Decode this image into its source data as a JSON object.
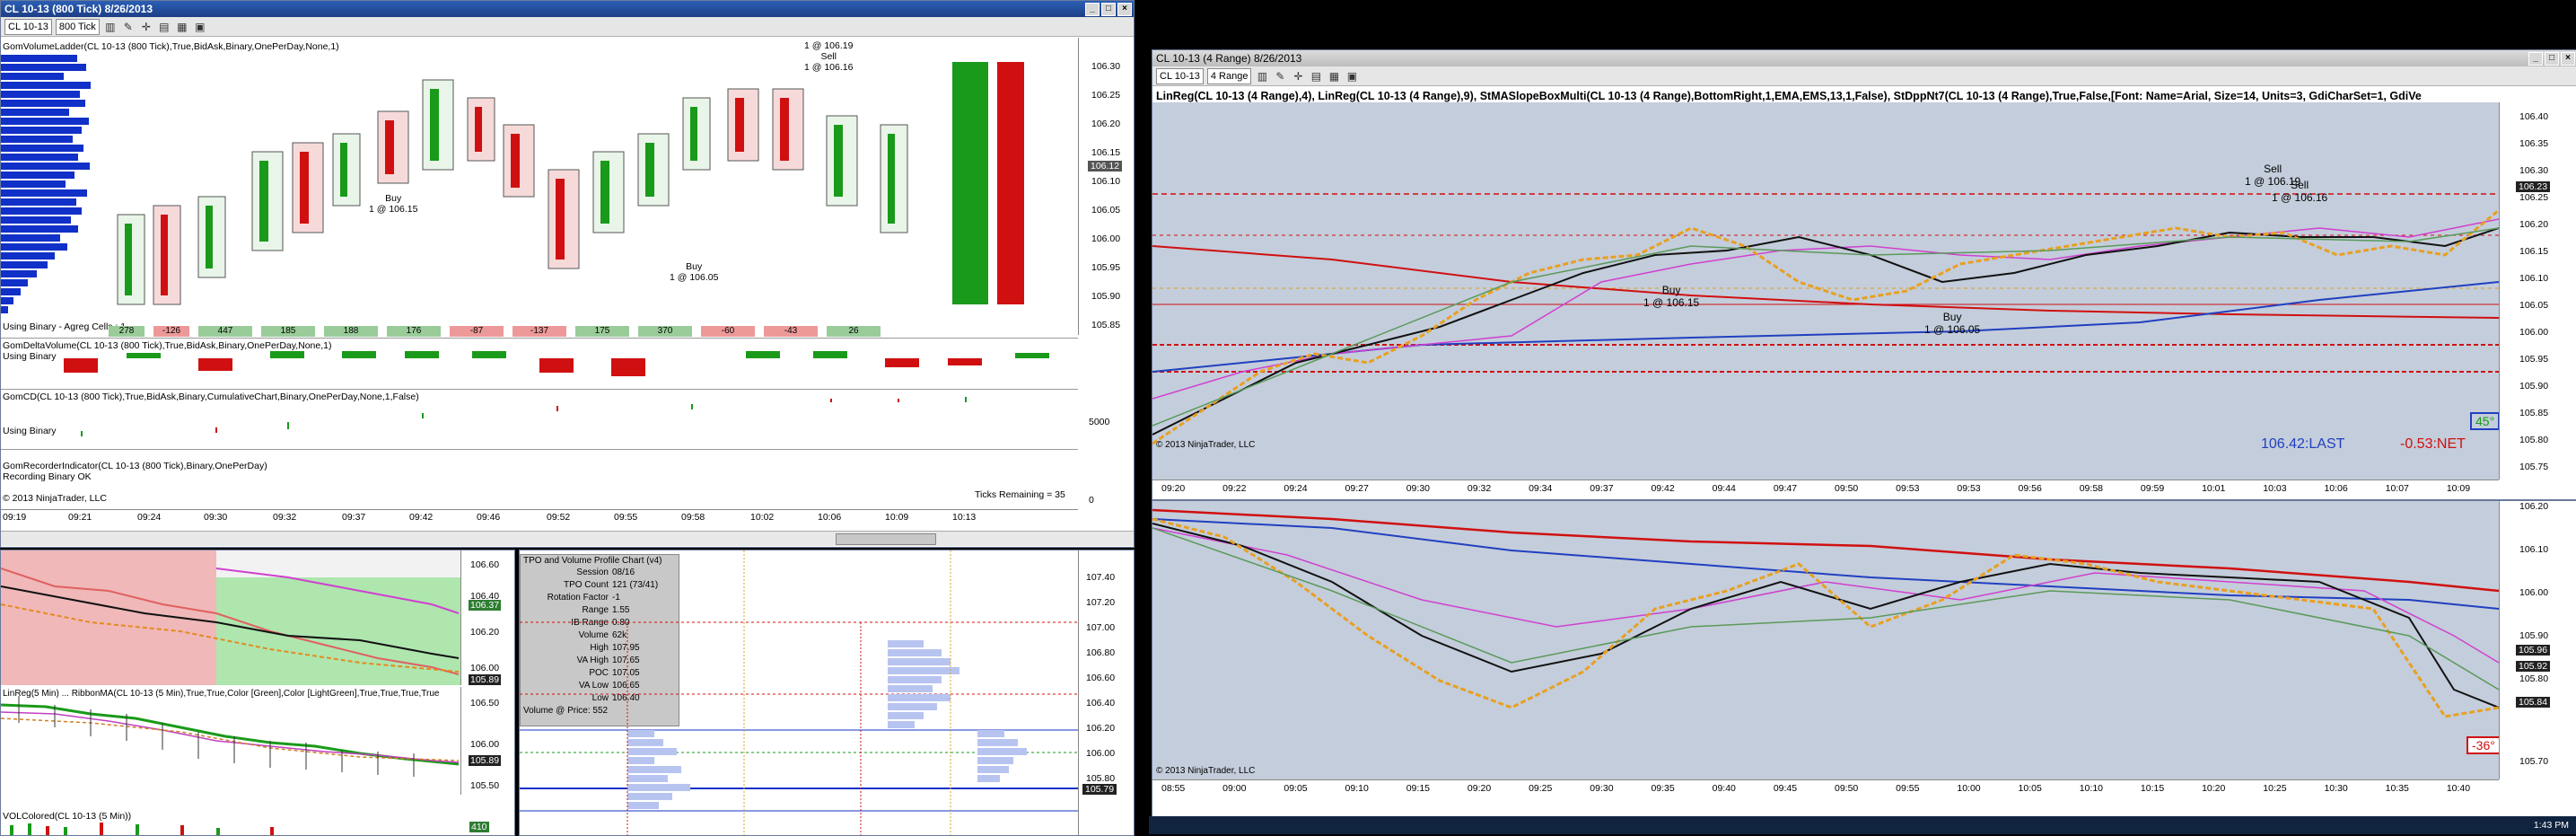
{
  "left_window": {
    "title": "CL 10-13 (800 Tick) 8/26/2013",
    "toolbar": {
      "instrument": "CL 10-13",
      "interval": "800 Tick"
    },
    "indicator_label": "GomVolumeLadder(CL 10-13 (800 Tick),True,BidAsk,Binary,OnePerDay,None,1)",
    "mode_label": "Using Binary - Agreg Cells : 1",
    "delta_label": "GomDeltaVolume(CL 10-13 (800 Tick),True,BidAsk,Binary,OnePerDay,None,1)",
    "delta_sub": "Using Binary",
    "cd_label": "GomCD(CL 10-13 (800 Tick),True,BidAsk,Binary,CumulativeChart,Binary,OnePerDay,None,1,False)",
    "cd_sub": "Using Binary",
    "recorder_label": "GomRecorderIndicator(CL 10-13 (800 Tick),Binary,OnePerDay)",
    "recorder_sub": "Recording Binary OK",
    "copyright": "© 2013 NinjaTrader, LLC",
    "ticks_remaining": "Ticks Remaining = 35",
    "cd_axis_value": "5000",
    "cd_axis_zero": "0",
    "delta_values": [
      "278",
      "-126",
      "447",
      "185",
      "188",
      "176",
      "-87",
      "-137",
      "175",
      "370",
      "-60",
      "-43",
      "26"
    ],
    "price_ticks": [
      "106.30",
      "106.25",
      "106.20",
      "106.15",
      "106.10",
      "106.05",
      "106.00",
      "105.95",
      "105.90",
      "105.85"
    ],
    "current_price": "106.12",
    "time_ticks": [
      "09:19",
      "09:21",
      "09:24",
      "09:30",
      "09:32",
      "09:37",
      "09:42",
      "09:46",
      "09:52",
      "09:55",
      "09:58",
      "10:02",
      "10:06",
      "10:09",
      "10:13"
    ],
    "trade_buy1": {
      "side": "Buy",
      "fill": "1 @ 106.15"
    },
    "trade_buy2": {
      "side": "Buy",
      "fill": "1 @ 106.05"
    },
    "trade_sell1": {
      "fill_top": "1 @ 106.19",
      "side": "Sell",
      "fill": "1 @ 106.16"
    }
  },
  "left_bottom": {
    "mini_chart_price_ticks": [
      "106.60",
      "106.40",
      "106.20",
      "106.00"
    ],
    "mini_chart_current": "106.37",
    "mini_chart_current2": "105.89",
    "mini2_label": "LinReg(5 Min) ... RibbonMA(CL 10-13 (5 Min),True,True,Color [Green],Color [LightGreen],True,True,True,True",
    "mini2_ticks": [
      "106.50",
      "106.00",
      "105.50"
    ],
    "mini2_current": "105.89",
    "vol_label": "VOLColored(CL 10-13 (5 Min))",
    "vol_value": "410"
  },
  "tpo_panel": {
    "title": "TPO and Volume Profile Chart (v4)",
    "rows": [
      {
        "k": "Session",
        "v": "08/16"
      },
      {
        "k": "TPO Count",
        "v": "121 (73/41)"
      },
      {
        "k": "Rotation Factor",
        "v": "-1"
      },
      {
        "k": "Range",
        "v": "1.55"
      },
      {
        "k": "IB Range",
        "v": "0.80"
      },
      {
        "k": "Volume",
        "v": "62k"
      },
      {
        "k": "High",
        "v": "107.95"
      },
      {
        "k": "VA High",
        "v": "107.65"
      },
      {
        "k": "POC",
        "v": "107.05"
      },
      {
        "k": "VA Low",
        "v": "106.65"
      },
      {
        "k": "Low",
        "v": "106.40"
      }
    ],
    "footer": "Volume @ Price: 552",
    "price_ticks": [
      "107.40",
      "107.20",
      "107.00",
      "106.80",
      "106.60",
      "106.40",
      "106.20",
      "106.00",
      "105.80"
    ],
    "current_price": "105.79"
  },
  "right_window": {
    "title": "CL 10-13 (4 Range) 8/26/2013",
    "toolbar": {
      "instrument": "CL 10-13",
      "interval": "4 Range"
    },
    "indicator_label": "LinReg(CL 10-13 (4 Range),4), LinReg(CL 10-13 (4 Range),9), StMASlopeBoxMulti(CL 10-13 (4 Range),BottomRight,1,EMA,EMS,13,1,False), StDppNt7(CL 10-13 (4 Range),True,False,[Font: Name=Arial, Size=14, Units=3, GdiCharSet=1, GdiVe",
    "price_ticks": [
      "106.40",
      "106.35",
      "106.30",
      "106.25",
      "106.20",
      "106.15",
      "106.10",
      "106.05",
      "106.00",
      "105.95",
      "105.90",
      "105.85",
      "105.80",
      "105.75"
    ],
    "current_price": "106.23",
    "last_label": "106.42:LAST",
    "net_label": "-0.53:NET",
    "angle_box": "45°",
    "copyright": "© 2013 NinjaTrader, LLC",
    "time_ticks": [
      "09:20",
      "09:22",
      "09:24",
      "09:27",
      "09:30",
      "09:32",
      "09:34",
      "09:37",
      "09:42",
      "09:44",
      "09:47",
      "09:50",
      "09:53",
      "09:53",
      "09:56",
      "09:58",
      "09:59",
      "10:01",
      "10:03",
      "10:06",
      "10:07",
      "10:09"
    ],
    "trade_buy1": {
      "side": "Buy",
      "fill": "1 @ 106.15"
    },
    "trade_buy2": {
      "side": "Buy",
      "fill": "1 @ 106.05"
    },
    "trade_sell": {
      "side": "Sell",
      "fill": "1 @ 106.19"
    },
    "trade_sell2": {
      "side": "Sell",
      "fill": "1 @ 106.16"
    }
  },
  "right_bottom": {
    "price_ticks": [
      "106.20",
      "106.10",
      "106.00",
      "105.90",
      "105.80",
      "105.70"
    ],
    "current_price": "105.96",
    "current_price2": "105.92",
    "current_price3": "105.84",
    "angle_box": "-36°",
    "copyright": "© 2013 NinjaTrader, LLC",
    "time_ticks": [
      "08:55",
      "09:00",
      "09:05",
      "09:10",
      "09:15",
      "09:20",
      "09:25",
      "09:30",
      "09:35",
      "09:40",
      "09:45",
      "09:50",
      "09:55",
      "10:00",
      "10:05",
      "10:10",
      "10:15",
      "10:20",
      "10:25",
      "10:30",
      "10:35",
      "10:40"
    ]
  },
  "taskbar": {
    "clock": "1:43 PM"
  },
  "colors": {
    "up_bar": "#1a9a1a",
    "down_bar": "#d01010",
    "panel_bg": "#c4cddb",
    "title_blue": "#1f4a9c"
  }
}
